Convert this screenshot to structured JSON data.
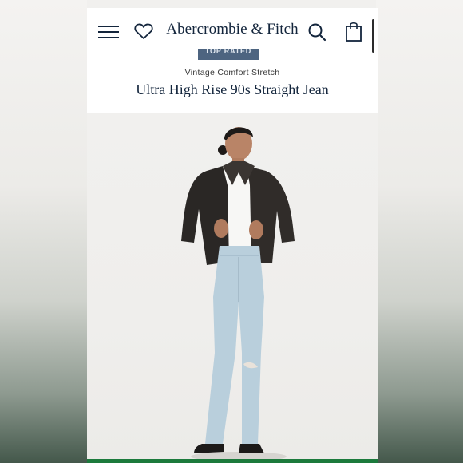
{
  "header": {
    "brand": "Abercrombie & Fitch"
  },
  "product": {
    "badge": "TOP RATED",
    "subtitle": "Vintage Comfort Stretch",
    "title": "Ultra High Rise 90s Straight Jean"
  },
  "colors": {
    "brand_navy": "#13253c",
    "badge_blue": "#4d6480",
    "cta_green": "#1c7a3c",
    "photo_bg": "#f1f0ee"
  },
  "icons": [
    "menu-icon",
    "heart-icon",
    "search-icon",
    "bag-icon"
  ]
}
